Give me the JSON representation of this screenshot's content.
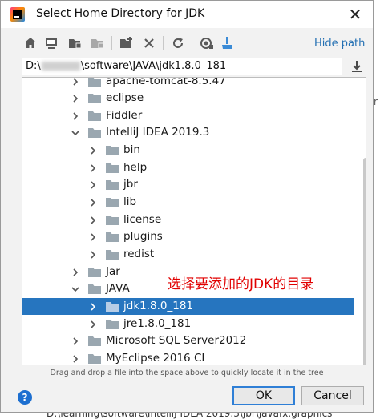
{
  "window": {
    "title": "Select Home Directory for JDK",
    "close_glyph": "✕"
  },
  "toolbar": {
    "buttons": [
      {
        "icon": "home-icon"
      },
      {
        "icon": "desktop-icon"
      },
      {
        "icon": "project-folder-icon"
      },
      {
        "icon": "module-folder-icon"
      },
      {
        "icon": "new-folder-icon"
      },
      {
        "icon": "delete-icon"
      },
      {
        "icon": "refresh-icon"
      },
      {
        "icon": "show-hidden-icon"
      },
      {
        "icon": "clear-cache-icon"
      }
    ],
    "hide_path_label": "Hide path"
  },
  "path_field": {
    "prefix": "D:\\",
    "suffix": "\\software\\JAVA\\jdk1.8.0_181"
  },
  "tree": {
    "items": [
      {
        "label": "apache-tomcat-8.5.47",
        "expanded": false,
        "selected": false
      },
      {
        "label": "eclipse",
        "expanded": false,
        "selected": false
      },
      {
        "label": "Fiddler",
        "expanded": false,
        "selected": false
      },
      {
        "label": "IntelliJ IDEA 2019.3",
        "expanded": true,
        "selected": false
      },
      {
        "label": "bin",
        "expanded": false,
        "selected": false
      },
      {
        "label": "help",
        "expanded": false,
        "selected": false
      },
      {
        "label": "jbr",
        "expanded": false,
        "selected": false
      },
      {
        "label": "lib",
        "expanded": false,
        "selected": false
      },
      {
        "label": "license",
        "expanded": false,
        "selected": false
      },
      {
        "label": "plugins",
        "expanded": false,
        "selected": false
      },
      {
        "label": "redist",
        "expanded": false,
        "selected": false
      },
      {
        "label": "Jar",
        "expanded": false,
        "selected": false
      },
      {
        "label": "JAVA",
        "expanded": true,
        "selected": false
      },
      {
        "label": "jdk1.8.0_181",
        "expanded": false,
        "selected": true
      },
      {
        "label": "jre1.8.0_181",
        "expanded": false,
        "selected": false
      },
      {
        "label": "Microsoft SQL Server2012",
        "expanded": false,
        "selected": false
      },
      {
        "label": "MyEclipse 2016 CI",
        "expanded": false,
        "selected": false
      }
    ],
    "annotation": "选择要添加的JDK的目录"
  },
  "hint": "Drag and drop a file into the space above to quickly locate it in the tree",
  "buttons": {
    "help": "?",
    "ok": "OK",
    "cancel": "Cancel"
  },
  "background": {
    "bottom_text": "D:\\learning\\software\\IntelliJ IDEA 2019.3\\jbr\\javafx.graphics"
  },
  "colors": {
    "selection": "#2675bf",
    "link": "#2470b3",
    "annotation": "#e10000",
    "folder": "#9aa7b0"
  }
}
